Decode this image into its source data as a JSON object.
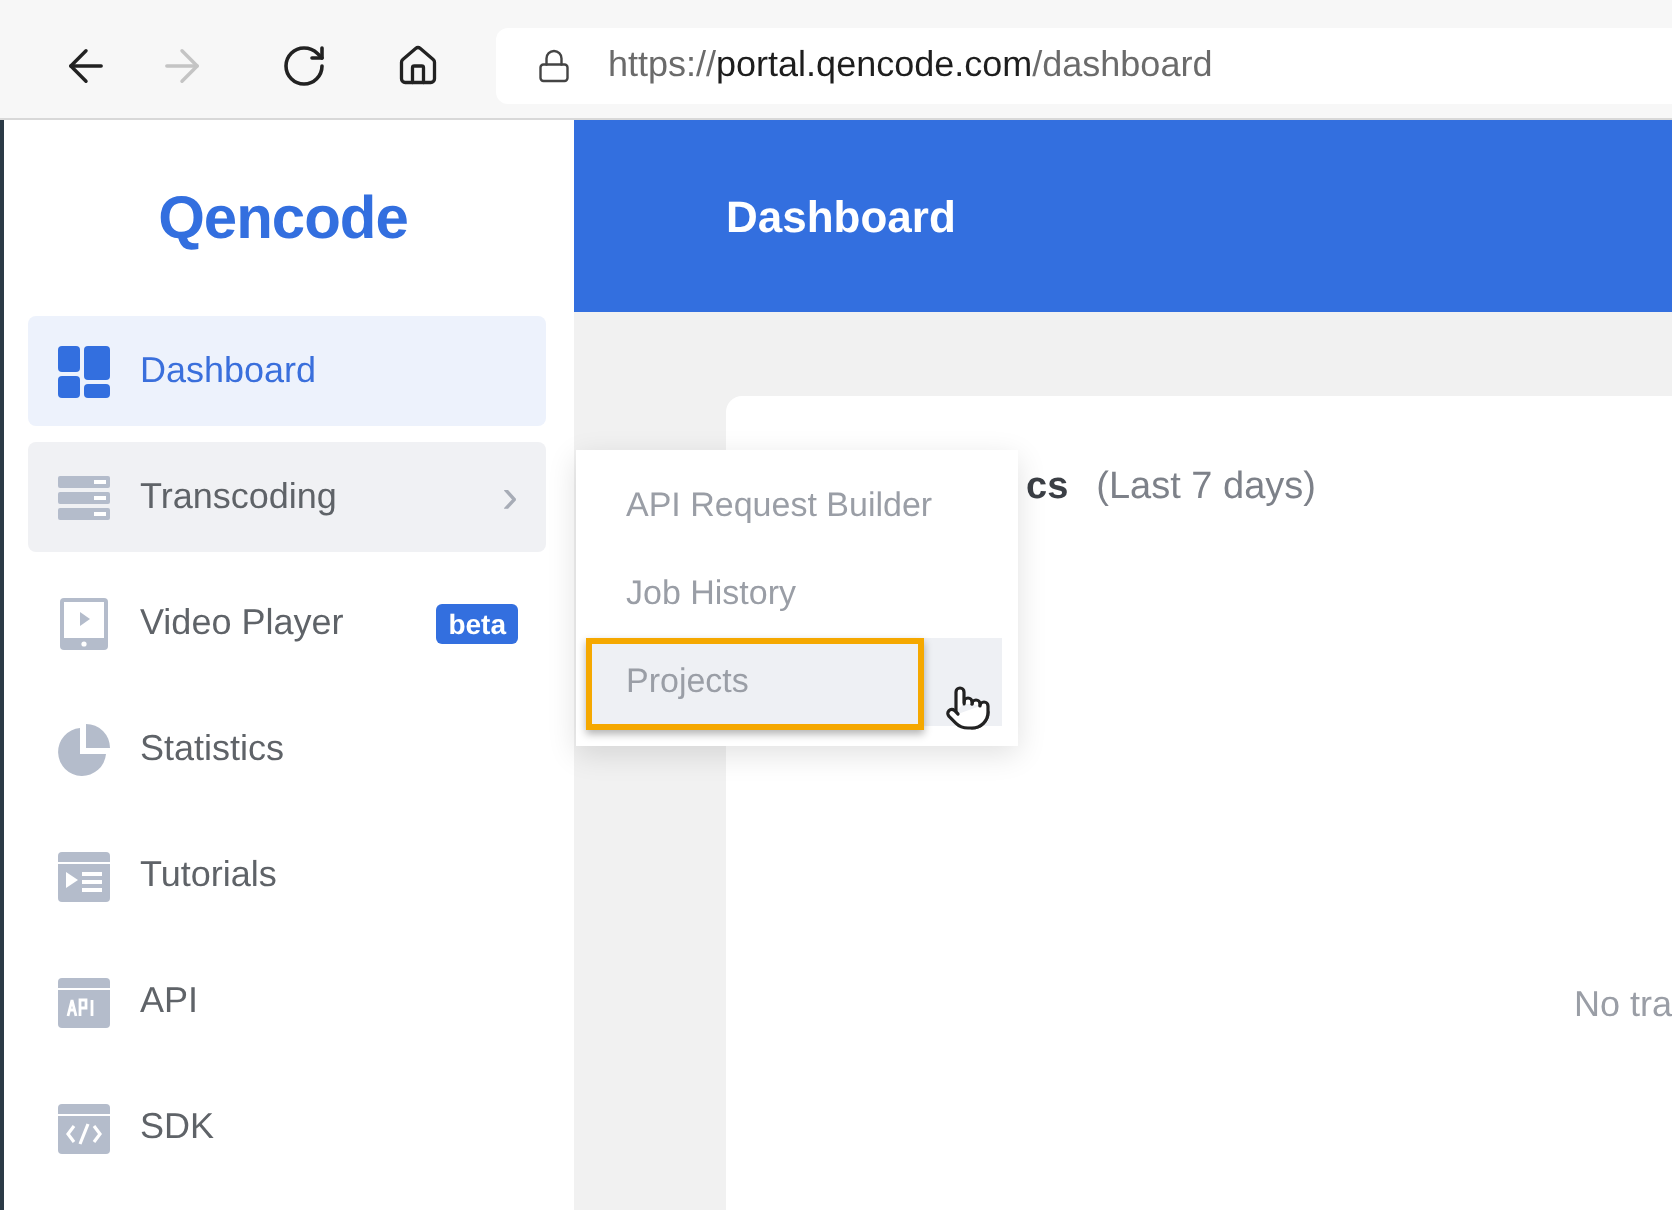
{
  "browser": {
    "forward_disabled": true,
    "url": {
      "scheme": "https://",
      "host": "portal.qencode.com",
      "path": "/dashboard"
    }
  },
  "logo": "Qencode",
  "sidebar": {
    "items": [
      {
        "label": "Dashboard",
        "selected": true,
        "expanded": false
      },
      {
        "label": "Transcoding",
        "selected": false,
        "expanded": true,
        "chevron": "›"
      },
      {
        "label": "Video Player",
        "selected": false,
        "expanded": false,
        "badge": "beta"
      },
      {
        "label": "Statistics",
        "selected": false,
        "expanded": false
      },
      {
        "label": "Tutorials",
        "selected": false,
        "expanded": false
      },
      {
        "label": "API",
        "selected": false,
        "expanded": false
      },
      {
        "label": "SDK",
        "selected": false,
        "expanded": false
      }
    ]
  },
  "header": {
    "title": "Dashboard"
  },
  "card": {
    "title": "cs",
    "subtitle": "(Last 7 days)",
    "empty_text": "No tra"
  },
  "submenu": {
    "items": [
      {
        "label": "API Request Builder",
        "selected": false
      },
      {
        "label": "Job History",
        "selected": false
      },
      {
        "label": "Projects",
        "selected": true
      }
    ]
  }
}
